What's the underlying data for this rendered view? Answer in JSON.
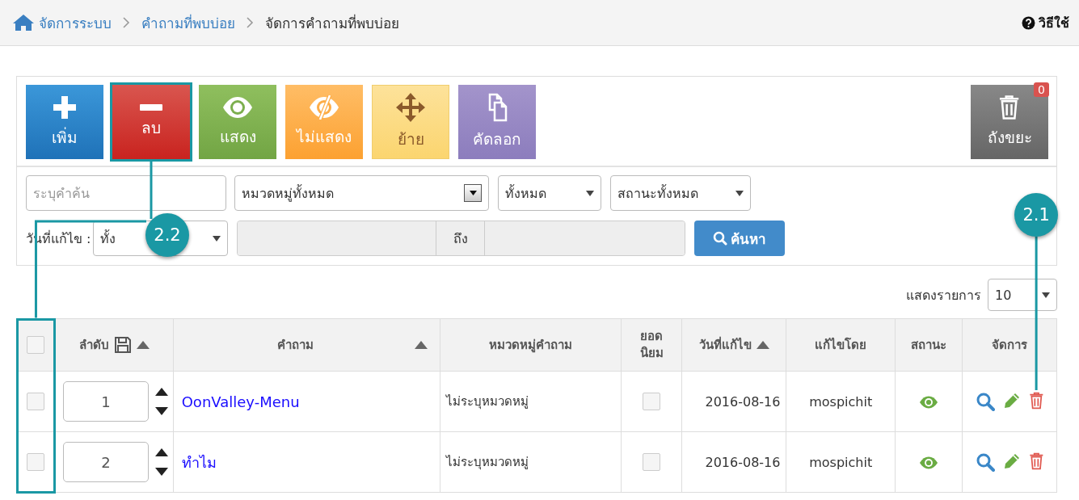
{
  "breadcrumb": [
    {
      "label": "จัดการระบบ",
      "kind": "home"
    },
    {
      "label": "คำถามที่พบบ่อย",
      "kind": "link"
    },
    {
      "label": "จัดการคำถามที่พบบ่อย",
      "kind": "current"
    }
  ],
  "help": {
    "label": "วิธีใช้"
  },
  "toolbar": [
    {
      "label": "เพิ่ม",
      "kind": "add",
      "highlighted": false
    },
    {
      "label": "ลบ",
      "kind": "delete",
      "highlighted": true
    },
    {
      "label": "แสดง",
      "kind": "show",
      "highlighted": false
    },
    {
      "label": "ไม่แสดง",
      "kind": "hide",
      "highlighted": false
    },
    {
      "label": "ย้าย",
      "kind": "move",
      "highlighted": false
    },
    {
      "label": "คัดลอก",
      "kind": "copy",
      "highlighted": false
    }
  ],
  "trash": {
    "label": "ถังขยะ",
    "count": "0"
  },
  "filters": {
    "search": {
      "placeholder": "ระบุคำค้น"
    },
    "category": {
      "value": "หมวดหมู่ทั้งหมด"
    },
    "scope": {
      "value": "ทั้งหมด"
    },
    "status": {
      "value": "สถานะทั้งหมด"
    },
    "date_label": "วันที่แก้ไข :",
    "date_range": {
      "value": "ทั้ง"
    },
    "range_separator": "ถึง",
    "search_button": "ค้นหา"
  },
  "page_size": {
    "label": "แสดงรายการ",
    "value": "10"
  },
  "table": {
    "columns": [
      {
        "kind": "check",
        "checked": false,
        "highlighted": true
      },
      {
        "kind": "order",
        "label": "ลำดับ",
        "sort": true
      },
      {
        "kind": "question",
        "label": "คำถาม",
        "sort": true
      },
      {
        "kind": "category",
        "label": "หมวดหมู่คำถาม",
        "sort": false
      },
      {
        "kind": "popular",
        "label": "ยอดนิยม",
        "sort": false
      },
      {
        "kind": "date",
        "label": "วันที่แก้ไข",
        "sort": true
      },
      {
        "kind": "editor",
        "label": "แก้ไขโดย",
        "sort": false
      },
      {
        "kind": "status",
        "label": "สถานะ",
        "sort": false
      },
      {
        "kind": "actions",
        "label": "จัดการ",
        "sort": false
      }
    ],
    "rows": [
      {
        "checked": false,
        "order": "1",
        "question": "OonValley-Menu",
        "category": "ไม่ระบุหมวดหมู่",
        "popular": false,
        "date": "2016-08-16",
        "editor": "mospichit",
        "visible": true
      },
      {
        "checked": false,
        "order": "2",
        "question": "ทำไม",
        "category": "ไม่ระบุหมวดหมู่",
        "popular": false,
        "date": "2016-08-16",
        "editor": "mospichit",
        "visible": true
      }
    ]
  },
  "callouts": [
    {
      "label": "2.1"
    },
    {
      "label": "2.2"
    }
  ]
}
